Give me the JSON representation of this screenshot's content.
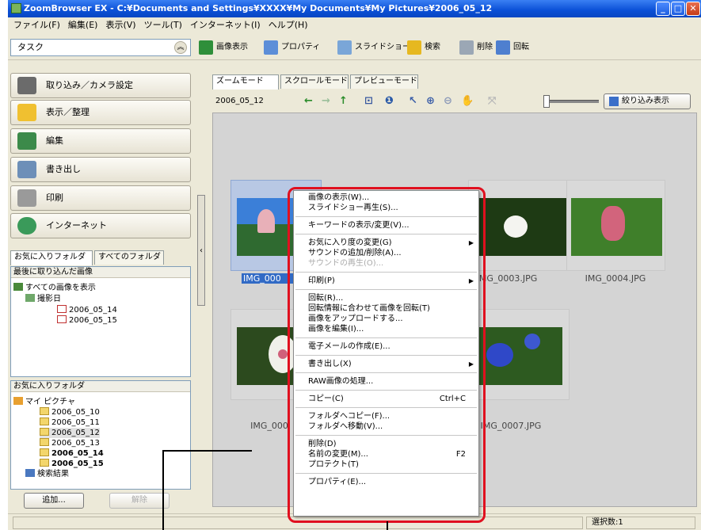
{
  "window": {
    "title": "ZoomBrowser EX - C:¥Documents and Settings¥XXXX¥My Documents¥My Pictures¥2006_05_12"
  },
  "menubar": [
    "ファイル(F)",
    "編集(E)",
    "表示(V)",
    "ツール(T)",
    "インターネット(I)",
    "ヘルプ(H)"
  ],
  "toolbar": {
    "task_label": "タスク",
    "buttons": [
      {
        "label": "画像表示",
        "icon": "image-view-icon"
      },
      {
        "label": "プロパティ",
        "icon": "properties-icon"
      },
      {
        "label": "スライドショー",
        "icon": "slideshow-icon"
      },
      {
        "label": "検索",
        "icon": "search-icon"
      },
      {
        "label": "削除",
        "icon": "trash-icon"
      },
      {
        "label": "回転",
        "icon": "rotate-icon"
      }
    ]
  },
  "nav": [
    {
      "label": "取り込み／カメラ設定",
      "icon": "camera-icon"
    },
    {
      "label": "表示／整理",
      "icon": "folder-icon"
    },
    {
      "label": "編集",
      "icon": "edit-icon"
    },
    {
      "label": "書き出し",
      "icon": "export-icon"
    },
    {
      "label": "印刷",
      "icon": "printer-icon"
    },
    {
      "label": "インターネット",
      "icon": "globe-icon"
    }
  ],
  "folder_tabs": {
    "favorites": "お気に入りフォルダ",
    "all": "すべてのフォルダ"
  },
  "recent_panel": {
    "title": "最後に取り込んだ画像",
    "root": "すべての画像を表示",
    "group": "撮影日",
    "dates": [
      "2006_05_14",
      "2006_05_15"
    ]
  },
  "favorites_panel": {
    "title": "お気に入りフォルダ",
    "root": "マイ ピクチャ",
    "folders": [
      "2006_05_10",
      "2006_05_11",
      "2006_05_12",
      "2006_05_13",
      "2006_05_14",
      "2006_05_15"
    ],
    "search": "検索結果",
    "add_button": "追加...",
    "remove_button": "解除"
  },
  "view_tabs": [
    "ズームモード",
    "スクロールモード",
    "プレビューモード"
  ],
  "current_folder": "2006_05_12",
  "filter_button": "絞り込み表示",
  "thumbnails": [
    {
      "caption": "IMG_000",
      "selected": true
    },
    {
      "caption": "IMG_0003.JPG",
      "selected": false
    },
    {
      "caption": "IMG_0004.JPG",
      "selected": false
    },
    {
      "caption": "IMG_000",
      "selected": false
    },
    {
      "caption": "IMG_0007.JPG",
      "selected": false
    }
  ],
  "status": {
    "selection": "選択数:1"
  },
  "context_menu": {
    "groups": [
      [
        {
          "label": "画像の表示(W)..."
        },
        {
          "label": "スライドショー再生(S)..."
        }
      ],
      [
        {
          "label": "キーワードの表示/変更(V)..."
        }
      ],
      [
        {
          "label": "お気に入り度の変更(G)",
          "submenu": true
        },
        {
          "label": "サウンドの追加/削除(A)..."
        },
        {
          "label": "サウンドの再生(O)...",
          "disabled": true
        }
      ],
      [
        {
          "label": "印刷(P)",
          "submenu": true
        }
      ],
      [
        {
          "label": "回転(R)..."
        },
        {
          "label": "回転情報に合わせて画像を回転(T)"
        },
        {
          "label": "画像をアップロードする..."
        },
        {
          "label": "画像を編集(I)..."
        }
      ],
      [
        {
          "label": "電子メールの作成(E)..."
        }
      ],
      [
        {
          "label": "書き出し(X)",
          "submenu": true
        }
      ],
      [
        {
          "label": "RAW画像の処理..."
        }
      ],
      [
        {
          "label": "コピー(C)",
          "shortcut": "Ctrl+C"
        }
      ],
      [
        {
          "label": "フォルダへコピー(F)..."
        },
        {
          "label": "フォルダへ移動(V)..."
        }
      ],
      [
        {
          "label": "削除(D)"
        },
        {
          "label": "名前の変更(M)...",
          "shortcut": "F2"
        },
        {
          "label": "プロテクト(T)"
        }
      ],
      [
        {
          "label": "プロパティ(E)..."
        }
      ]
    ]
  },
  "colors": {
    "callout": "#e0101f",
    "title_blue": "#0a4fd6",
    "selection": "#316ac5"
  }
}
